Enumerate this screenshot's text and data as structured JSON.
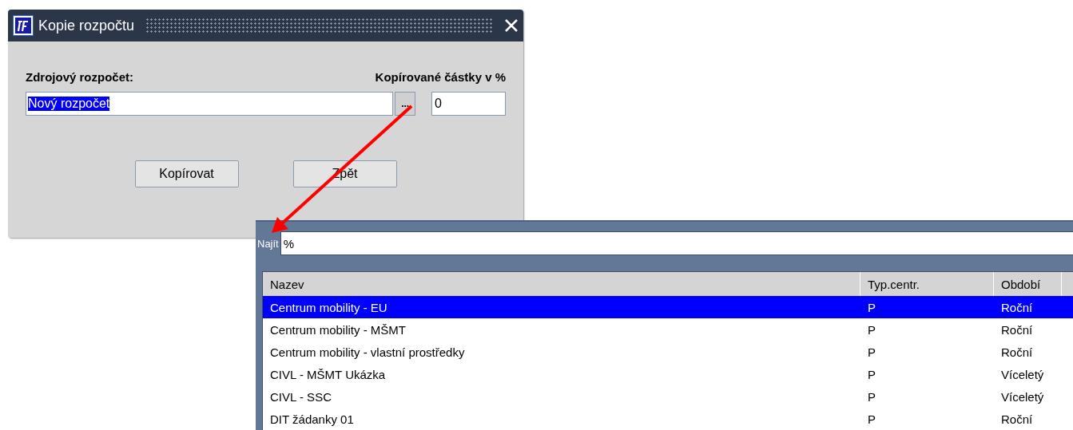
{
  "dialog": {
    "title": "Kopie rozpočtu",
    "source_label": "Zdrojový rozpočet:",
    "percent_label": "Kopírované částky v %",
    "source_value": "Nový rozpočet",
    "lookup_button": "...",
    "percent_value": "0",
    "buttons": [
      "Kopírovat",
      "Zpět"
    ]
  },
  "list": {
    "search_label": "Najít",
    "search_value": "%",
    "columns": [
      "Nazev",
      "Typ.centr.",
      "Období"
    ],
    "rows": [
      {
        "cells": [
          "Centrum mobility - EU",
          "P",
          "Roční"
        ],
        "selected": true
      },
      {
        "cells": [
          "Centrum mobility - MŠMT",
          "P",
          "Roční"
        ],
        "selected": false
      },
      {
        "cells": [
          "Centrum mobility - vlastní prostředky",
          "P",
          "Roční"
        ],
        "selected": false
      },
      {
        "cells": [
          "CIVL - MŠMT Ukázka",
          "P",
          "Víceletý"
        ],
        "selected": false
      },
      {
        "cells": [
          "CIVL - SSC",
          "P",
          "Víceletý"
        ],
        "selected": false
      },
      {
        "cells": [
          "DIT žádanky 01",
          "P",
          "Roční"
        ],
        "selected": false
      }
    ]
  }
}
